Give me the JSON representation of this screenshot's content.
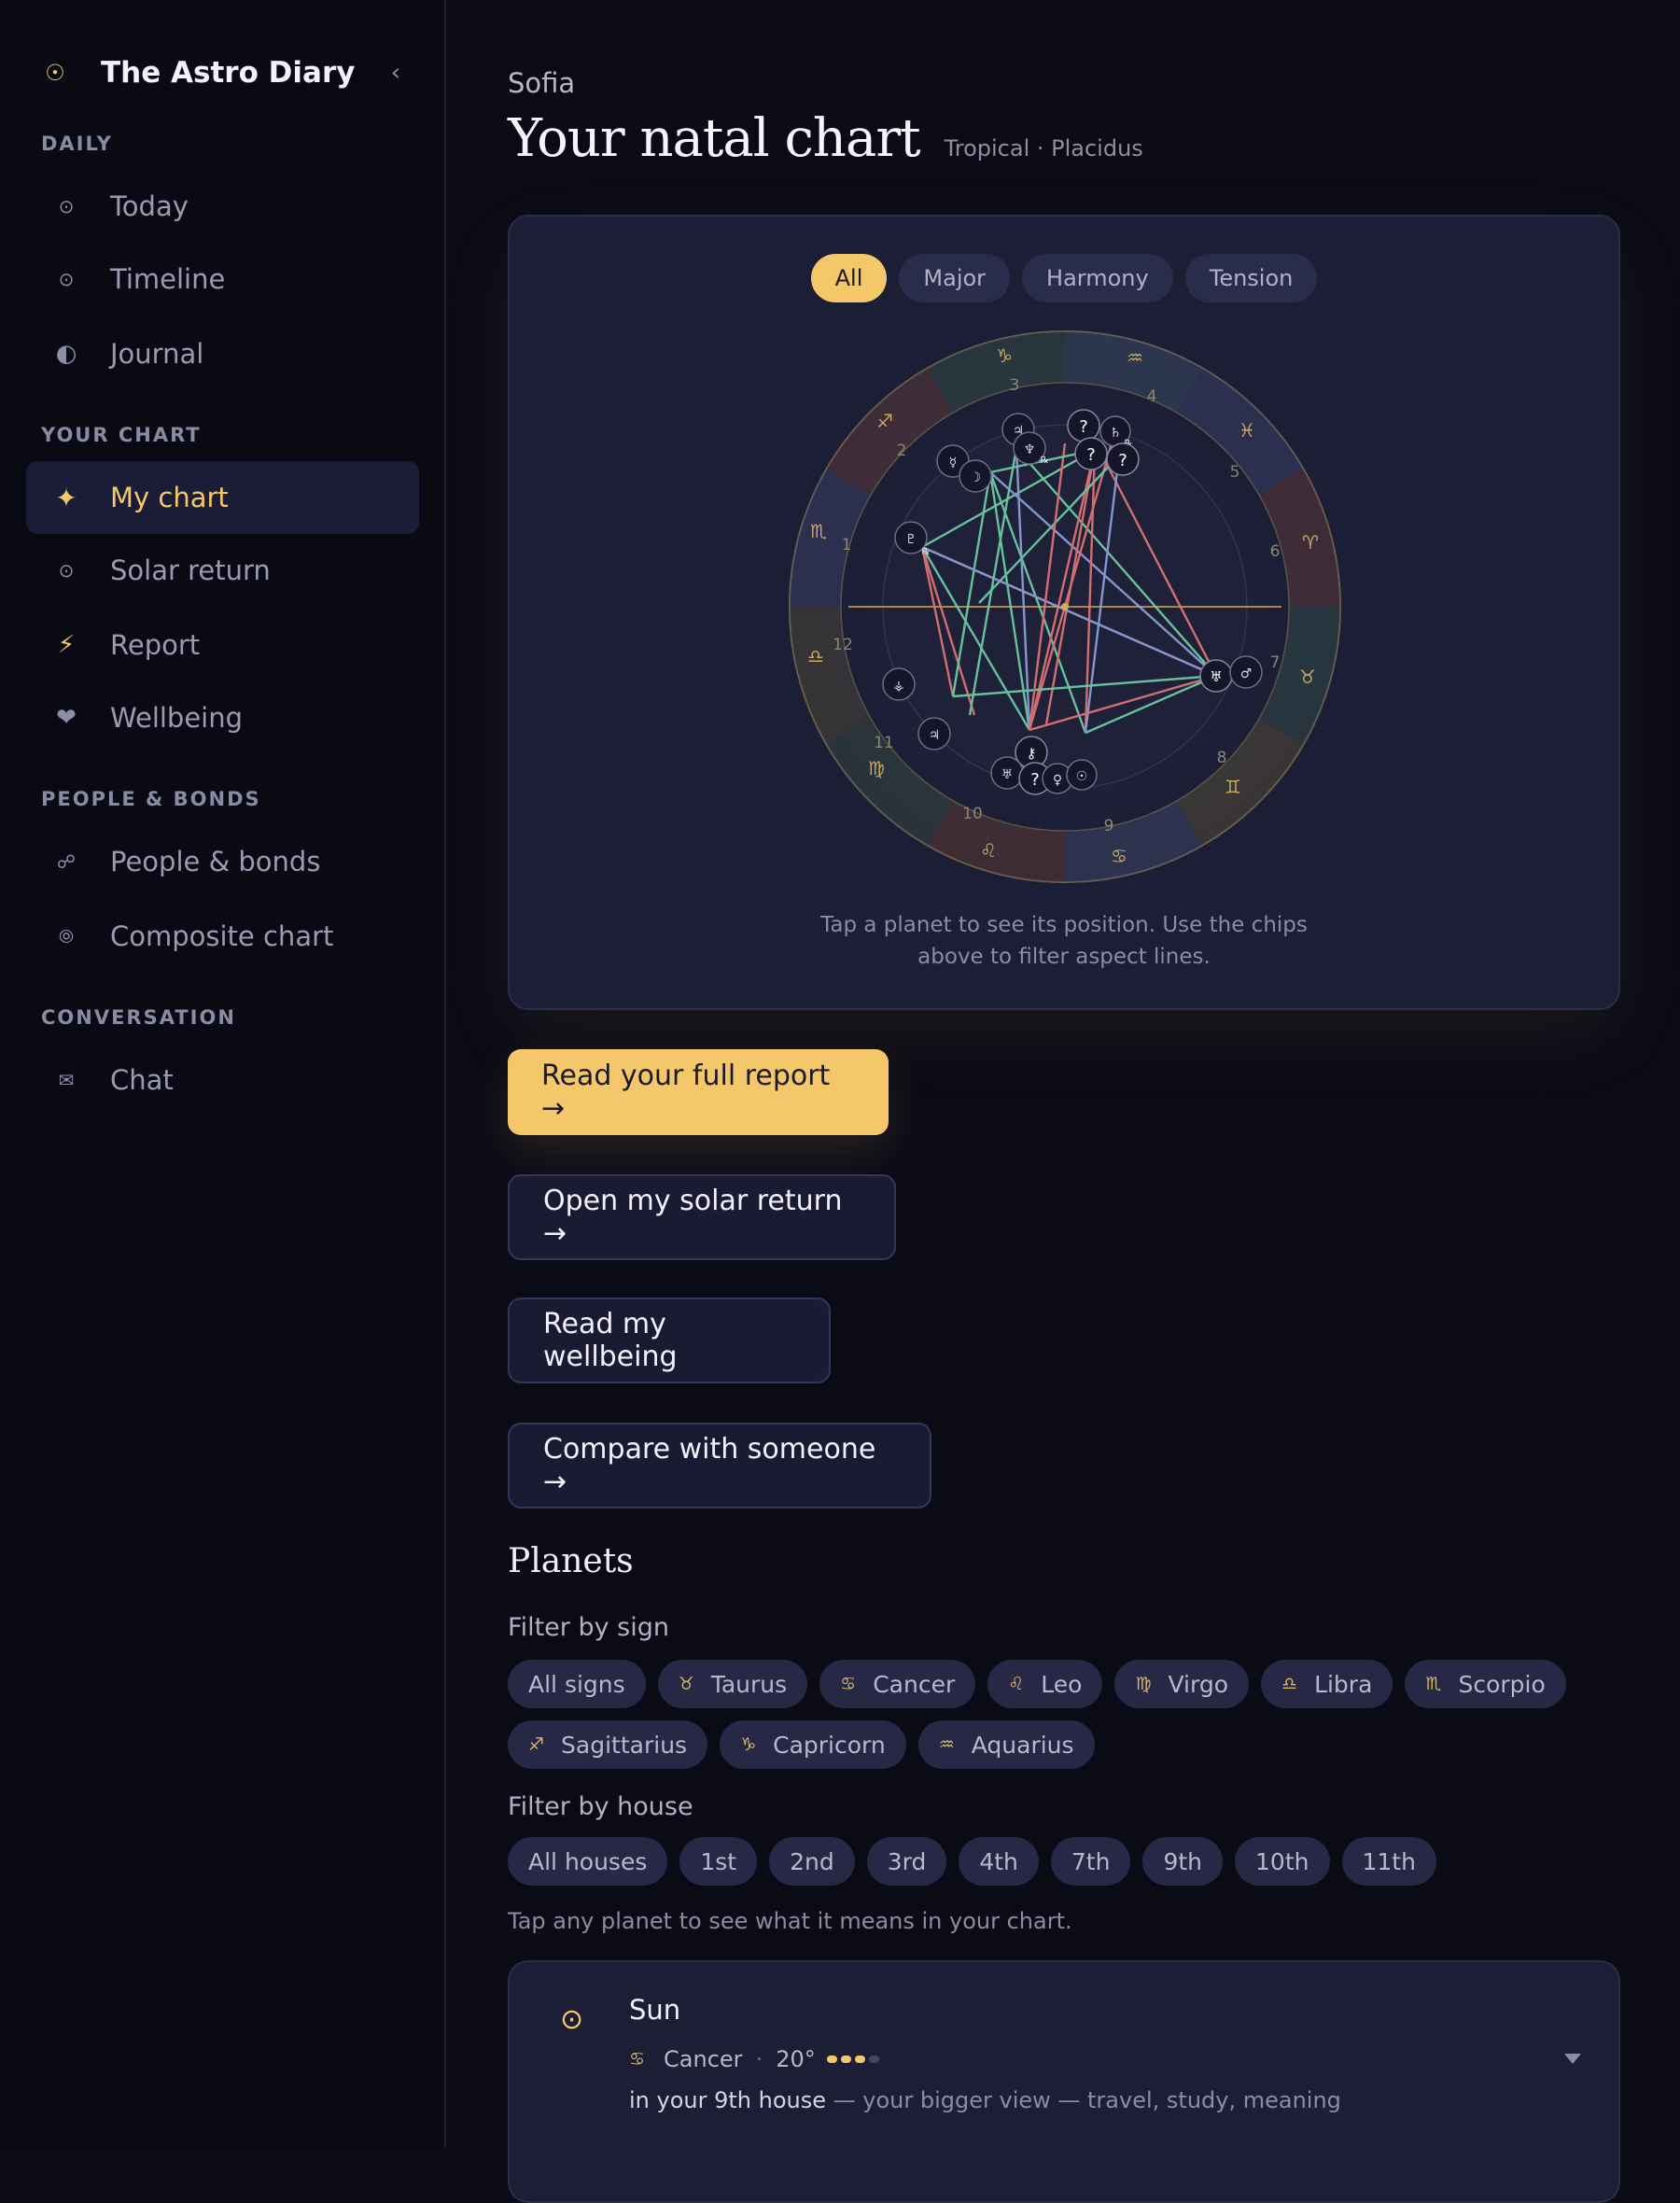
{
  "app": {
    "title": "The Astro Diary"
  },
  "sidebar": {
    "sections": [
      {
        "label": "DAILY"
      },
      {
        "label": "YOUR CHART"
      },
      {
        "label": "PEOPLE & BONDS"
      },
      {
        "label": "CONVERSATION"
      }
    ],
    "items": [
      {
        "label": "Today",
        "icon": "sun-icon"
      },
      {
        "label": "Timeline",
        "icon": "sun-icon"
      },
      {
        "label": "Journal",
        "icon": "half-moon-icon"
      },
      {
        "label": "My chart",
        "icon": "sparkle-icon",
        "active": true
      },
      {
        "label": "Solar return",
        "icon": "sun-icon"
      },
      {
        "label": "Report",
        "icon": "lightning-icon"
      },
      {
        "label": "Wellbeing",
        "icon": "heart-icon"
      },
      {
        "label": "People & bonds",
        "icon": "link-icon"
      },
      {
        "label": "Composite chart",
        "icon": "rings-icon"
      },
      {
        "label": "Chat",
        "icon": "envelope-icon"
      }
    ]
  },
  "header": {
    "user": "Sofia",
    "title": "Your natal chart",
    "subtitle": "Tropical · Placidus"
  },
  "chart": {
    "filters": [
      "All",
      "Major",
      "Harmony",
      "Tension"
    ],
    "active_filter": "All",
    "hint": "Tap a planet to see its position. Use the chips above to filter aspect lines.",
    "colors": {
      "harmony": "#6fd3a6",
      "tension": "#e57777",
      "neutral": "#8fa3dd",
      "accent": "#f4c76b"
    }
  },
  "actions": {
    "report": "Read your full report →",
    "solar_return": "Open my solar return →",
    "wellbeing": "Read my wellbeing",
    "compare": "Compare with someone →"
  },
  "planets_section": {
    "title": "Planets",
    "sign_filter_label": "Filter by sign",
    "signs": [
      {
        "label": "All signs",
        "glyph": ""
      },
      {
        "label": "Taurus",
        "glyph": "♉"
      },
      {
        "label": "Cancer",
        "glyph": "♋"
      },
      {
        "label": "Leo",
        "glyph": "♌"
      },
      {
        "label": "Virgo",
        "glyph": "♍"
      },
      {
        "label": "Libra",
        "glyph": "♎"
      },
      {
        "label": "Scorpio",
        "glyph": "♏"
      },
      {
        "label": "Sagittarius",
        "glyph": "♐"
      },
      {
        "label": "Capricorn",
        "glyph": "♑"
      },
      {
        "label": "Aquarius",
        "glyph": "♒"
      }
    ],
    "house_filter_label": "Filter by house",
    "houses": [
      "All houses",
      "1st",
      "2nd",
      "3rd",
      "4th",
      "7th",
      "9th",
      "10th",
      "11th"
    ],
    "hint": "Tap any planet to see what it means in your chart.",
    "first_planet": {
      "name": "Sun",
      "sign": "Cancer",
      "sign_glyph": "♋",
      "degree": "20°",
      "strength": 3,
      "strength_max": 4,
      "house_text": "in your 9th house",
      "house_desc": "— your bigger view — travel, study, meaning"
    }
  }
}
